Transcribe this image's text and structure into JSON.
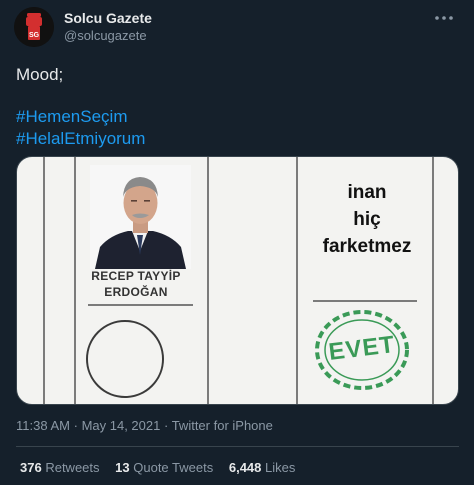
{
  "account": {
    "display_name": "Solcu Gazete",
    "handle": "@solcugazete",
    "avatar_text": "SG"
  },
  "tweet": {
    "lines": [
      "Mood;",
      "#HemenSeçim",
      "#HelalEtmiyorum"
    ]
  },
  "media": {
    "candidate_name_line1": "RECEP TAYYİP",
    "candidate_name_line2": "ERDOĞAN",
    "caption_line1": "inan",
    "caption_line2": "hiç",
    "caption_line3": "farketmez",
    "stamp_text": "EVET",
    "stamp_color": "#3a9a57"
  },
  "meta": {
    "time": "11:38 AM",
    "date": "May 14, 2021",
    "source": "Twitter for iPhone",
    "separator": "·"
  },
  "stats": {
    "retweets_count": "376",
    "retweets_label": "Retweets",
    "quotes_count": "13",
    "quotes_label": "Quote Tweets",
    "likes_count": "6,448",
    "likes_label": "Likes"
  },
  "colors": {
    "background": "#15202b",
    "hashtag": "#1d9bf0",
    "muted": "#8b98a5",
    "border": "#38444d"
  }
}
